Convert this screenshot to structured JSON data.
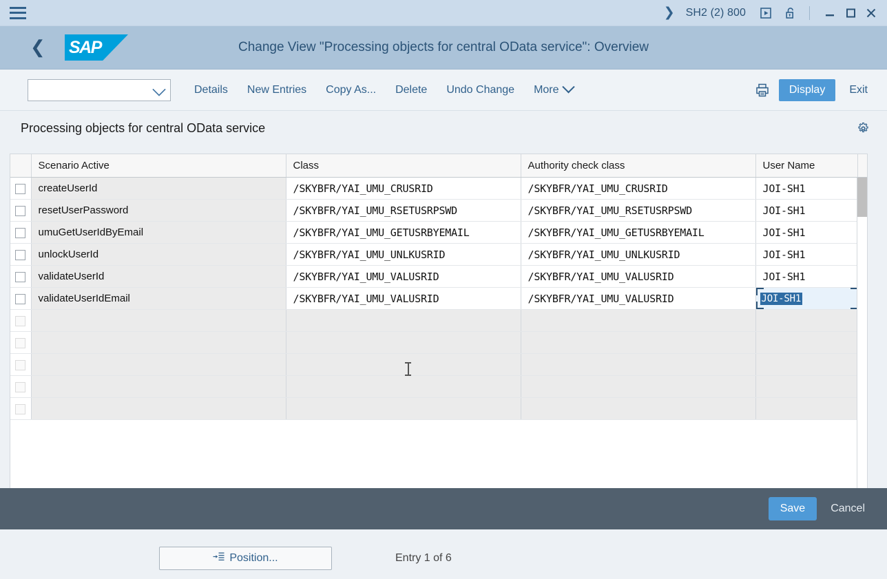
{
  "titlebar": {
    "menu_icon": "hamburger-icon",
    "expand_icon": "chevron-right-icon",
    "session": "SH2 (2) 800",
    "play_icon": "play-boxed-icon",
    "lock_icon": "unlocked-padlock-icon",
    "minimize": "_",
    "maximize": "☐",
    "close": "✕"
  },
  "header": {
    "back_icon": "chevron-left-icon",
    "logo_text": "SAP",
    "title": "Change View \"Processing objects for central OData service\": Overview"
  },
  "toolbar": {
    "select_value": "",
    "buttons": [
      {
        "label": "Details"
      },
      {
        "label": "New Entries"
      },
      {
        "label": "Copy As..."
      },
      {
        "label": "Delete"
      },
      {
        "label": "Undo Change"
      },
      {
        "label": "More",
        "has_caret": true
      }
    ],
    "print_icon": "printer-icon",
    "display_label": "Display",
    "exit_label": "Exit"
  },
  "section": {
    "title": "Processing objects for central OData service",
    "settings_icon": "gear-icon"
  },
  "table": {
    "columns": [
      "Scenario Active",
      "Class",
      "Authority check class",
      "User Name"
    ],
    "rows": [
      {
        "scenario": "createUserId",
        "class": "/SKYBFR/YAI_UMU_CRUSRID",
        "authority": "/SKYBFR/YAI_UMU_CRUSRID",
        "user": "JOI-SH1"
      },
      {
        "scenario": "resetUserPassword",
        "class": "/SKYBFR/YAI_UMU_RSETUSRPSWD",
        "authority": "/SKYBFR/YAI_UMU_RSETUSRPSWD",
        "user": "JOI-SH1"
      },
      {
        "scenario": "umuGetUserIdByEmail",
        "class": "/SKYBFR/YAI_UMU_GETUSRBYEMAIL",
        "authority": "/SKYBFR/YAI_UMU_GETUSRBYEMAIL",
        "user": "JOI-SH1"
      },
      {
        "scenario": "unlockUserId",
        "class": "/SKYBFR/YAI_UMU_UNLKUSRID",
        "authority": "/SKYBFR/YAI_UMU_UNLKUSRID",
        "user": "JOI-SH1"
      },
      {
        "scenario": "validateUserId",
        "class": "/SKYBFR/YAI_UMU_VALUSRID",
        "authority": "/SKYBFR/YAI_UMU_VALUSRID",
        "user": "JOI-SH1"
      },
      {
        "scenario": "validateUserIdEmail",
        "class": "/SKYBFR/YAI_UMU_VALUSRID",
        "authority": "/SKYBFR/YAI_UMU_VALUSRID",
        "user": "JOI-SH1",
        "user_selected": true
      }
    ],
    "empty_row_count": 5
  },
  "below": {
    "position_label": "Position...",
    "position_icon": "position-list-icon",
    "entry_text": "Entry 1 of 6"
  },
  "footer": {
    "save_label": "Save",
    "cancel_label": "Cancel"
  },
  "colors": {
    "titlebar_bg": "#cbdbeb",
    "header_bg": "#abc3d9",
    "accent_blue": "#4f9ad7",
    "link_blue": "#31618c",
    "sap_logo_blue": "#00a0dc",
    "footer_bg": "#51606e",
    "selection_blue": "#2e6ca4"
  }
}
